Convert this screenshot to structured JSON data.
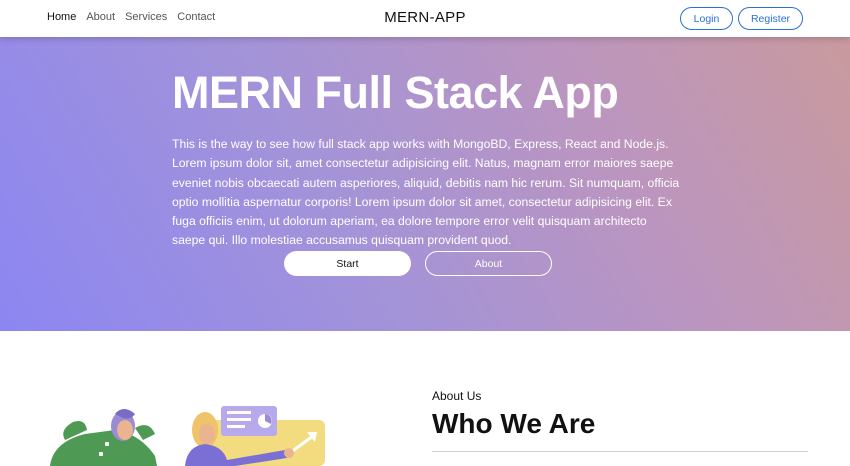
{
  "navbar": {
    "links": [
      "Home",
      "About",
      "Services",
      "Contact"
    ],
    "brand": "MERN-APP",
    "login_label": "Login",
    "register_label": "Register"
  },
  "hero": {
    "title": "MERN Full Stack App",
    "description": "This is the way to see how full stack app works with MongoBD, Express, React and Node.js. Lorem ipsum dolor sit, amet consectetur adipisicing elit. Natus, magnam error maiores saepe eveniet nobis obcaecati autem asperiores, aliquid, debitis nam hic rerum. Sit numquam, officia optio mollitia aspernatur corporis! Lorem ipsum dolor sit amet, consectetur adipisicing elit. Ex fuga officiis enim, ut dolorum aperiam, ea dolore tempore error velit quisquam architecto saepe qui. Illo molestiae accusamus quisquam provident quod.",
    "start_label": "Start",
    "about_label": "About"
  },
  "about": {
    "label": "About Us",
    "heading_prefix": "Who",
    "heading_bold": "We",
    "heading_suffix": "Are"
  },
  "colors": {
    "accent": "#2b6fd9",
    "hero_gradient_start": "#8c86f2",
    "hero_gradient_end": "#c99a9e"
  }
}
